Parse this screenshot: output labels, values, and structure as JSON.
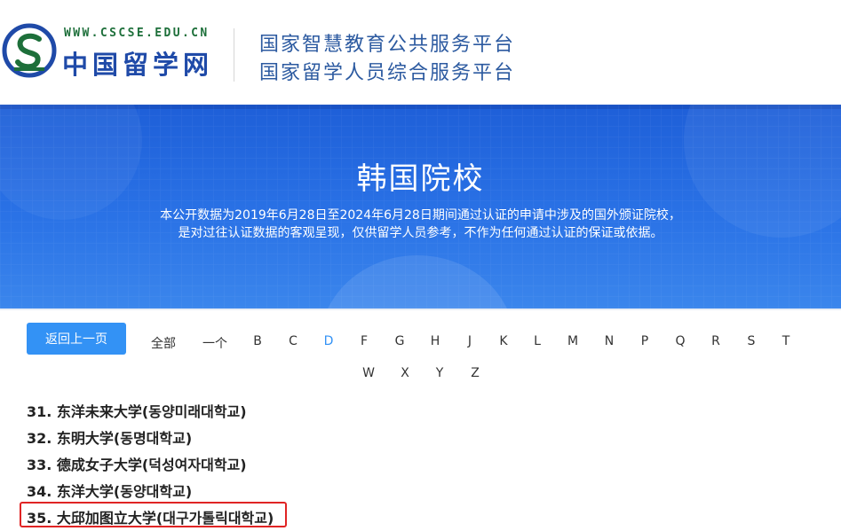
{
  "header": {
    "logo_url": "WWW.CSCSE.EDU.CN",
    "logo_text": "中国留学网",
    "platform_line1": "国家智慧教育公共服务平台",
    "platform_line2": "国家留学人员综合服务平台"
  },
  "banner": {
    "title": "韩国院校",
    "desc_line1": "本公开数据为2019年6月28日至2024年6月28日期间通过认证的申请中涉及的国外颁证院校，",
    "desc_line2": "是对过往认证数据的客观呈现，仅供留学人员参考，不作为任何通过认证的保证或依据。"
  },
  "nav": {
    "back_label": "返回上一页",
    "all_label": "全部",
    "letters": [
      "一个",
      "B",
      "C",
      "D",
      "F",
      "G",
      "H",
      "J",
      "K",
      "L",
      "M",
      "N",
      "P",
      "Q",
      "R",
      "S",
      "T",
      "W",
      "X",
      "Y",
      "Z"
    ],
    "active_letter": "D"
  },
  "list": {
    "items": [
      "31. 东洋未来大学(동양미래대학교)",
      "32. 东明大学(동명대학교)",
      "33. 德成女子大学(덕성여자대학교)",
      "34. 东洋大学(동양대학교)",
      "35. 大邱加图立大学(대구가톨릭대학교)"
    ],
    "highlighted_index": 4,
    "highlight_color": "#e02424"
  },
  "colors": {
    "accent": "#3392f5",
    "banner": "#2a72e6"
  }
}
